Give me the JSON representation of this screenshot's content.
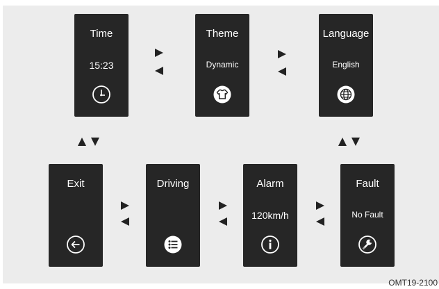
{
  "cards": {
    "time": {
      "title": "Time",
      "value": "15:23",
      "icon": "clock-icon"
    },
    "theme": {
      "title": "Theme",
      "value": "Dynamic",
      "icon": "tshirt-icon"
    },
    "language": {
      "title": "Language",
      "value": "English",
      "icon": "globe-icon"
    },
    "exit": {
      "title": "Exit",
      "icon": "back-arrow-icon"
    },
    "driving": {
      "title": "Driving",
      "icon": "list-icon"
    },
    "alarm": {
      "title": "Alarm",
      "value": "120km/h",
      "icon": "info-icon"
    },
    "fault": {
      "title": "Fault",
      "value": "No Fault",
      "icon": "wrench-icon"
    }
  },
  "figure_code": "OMT19-2100",
  "colors": {
    "card_bg": "#262626",
    "panel_bg": "#ececec",
    "arrow": "#222222",
    "text": "#ffffff"
  }
}
